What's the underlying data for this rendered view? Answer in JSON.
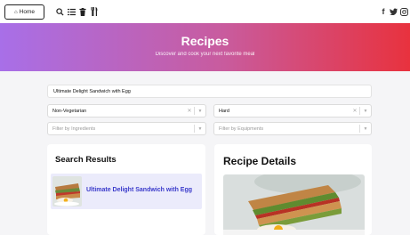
{
  "nav": {
    "home_label": "Home",
    "icons": [
      "search-icon",
      "list-icon",
      "trash-icon",
      "utensils-icon"
    ],
    "social": [
      "facebook-icon",
      "twitter-icon",
      "instagram-icon"
    ]
  },
  "hero": {
    "title": "Recipes",
    "subtitle": "Discover and cook your next favorite meal"
  },
  "search": {
    "value": "Ultimate Delight Sandwich with Egg"
  },
  "filters": {
    "diet": "Non-Vegetarian",
    "difficulty": "Hard",
    "ingredients_placeholder": "Filter by Ingredients",
    "equipments_placeholder": "Filter by Equipments"
  },
  "results": {
    "title": "Search Results",
    "items": [
      {
        "name": "Ultimate Delight Sandwich with Egg"
      }
    ]
  },
  "details": {
    "title": "Recipe Details"
  },
  "colors": {
    "hero_start": "#a86fe8",
    "hero_end": "#e8323e",
    "result_highlight": "#ebebfb",
    "result_text": "#3a3acb"
  }
}
